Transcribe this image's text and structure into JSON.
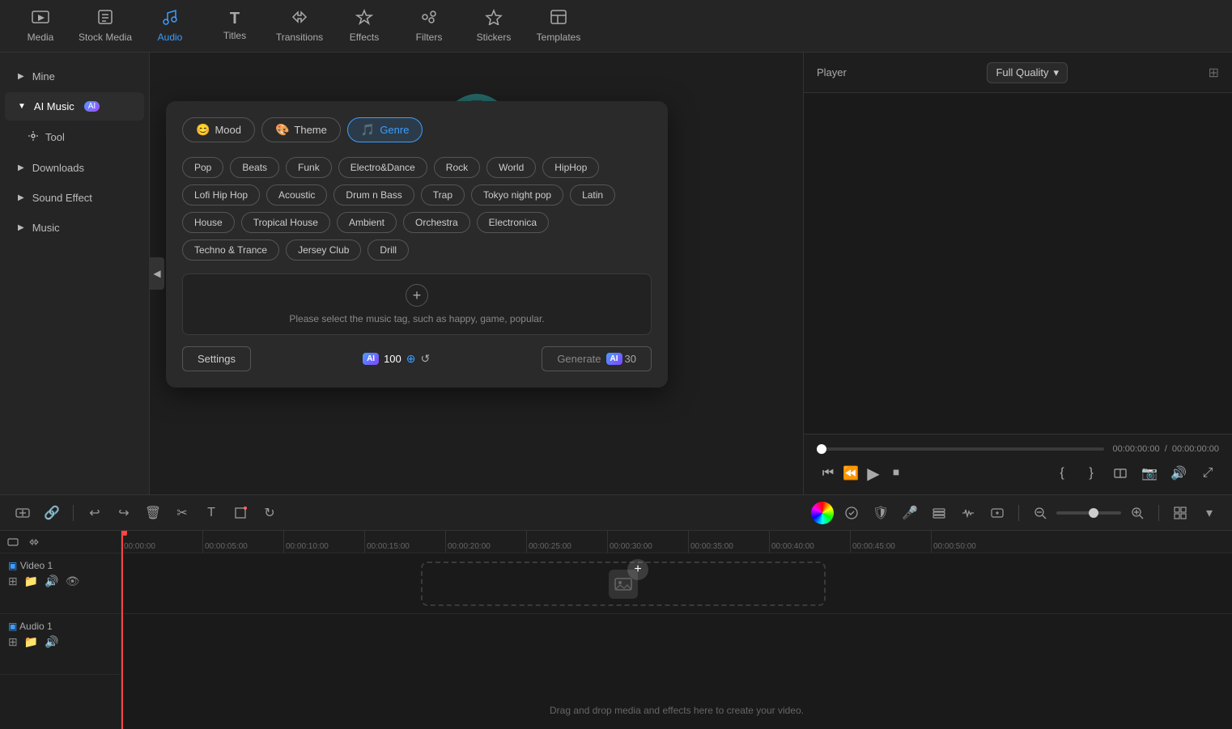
{
  "nav": {
    "items": [
      {
        "id": "media",
        "label": "Media",
        "icon": "🖼"
      },
      {
        "id": "stock-media",
        "label": "Stock Media",
        "icon": "📦"
      },
      {
        "id": "audio",
        "label": "Audio",
        "icon": "🎵",
        "active": true
      },
      {
        "id": "titles",
        "label": "Titles",
        "icon": "T"
      },
      {
        "id": "transitions",
        "label": "Transitions",
        "icon": "↔"
      },
      {
        "id": "effects",
        "label": "Effects",
        "icon": "✨"
      },
      {
        "id": "filters",
        "label": "Filters",
        "icon": "🎛"
      },
      {
        "id": "stickers",
        "label": "Stickers",
        "icon": "⭐"
      },
      {
        "id": "templates",
        "label": "Templates",
        "icon": "⊟"
      }
    ]
  },
  "sidebar": {
    "items": [
      {
        "id": "mine",
        "label": "Mine",
        "caret": "▶",
        "expanded": false
      },
      {
        "id": "ai-music",
        "label": "AI Music",
        "caret": "▼",
        "expanded": true,
        "badge": "AI"
      },
      {
        "id": "tool",
        "label": "Tool",
        "icon": "🔧"
      },
      {
        "id": "downloads",
        "label": "Downloads",
        "caret": "▶",
        "expanded": false
      },
      {
        "id": "sound-effect",
        "label": "Sound Effect",
        "caret": "▶",
        "expanded": false
      },
      {
        "id": "music",
        "label": "Music",
        "caret": "▶",
        "expanded": false
      }
    ]
  },
  "ai_panel": {
    "tabs": [
      {
        "id": "mood",
        "label": "Mood",
        "icon": "😊"
      },
      {
        "id": "theme",
        "label": "Theme",
        "icon": "🎨"
      },
      {
        "id": "genre",
        "label": "Genre",
        "icon": "🎵",
        "active": true
      }
    ],
    "genres": [
      {
        "id": "pop",
        "label": "Pop"
      },
      {
        "id": "beats",
        "label": "Beats"
      },
      {
        "id": "funk",
        "label": "Funk"
      },
      {
        "id": "electro-dance",
        "label": "Electro&Dance"
      },
      {
        "id": "rock",
        "label": "Rock"
      },
      {
        "id": "world",
        "label": "World"
      },
      {
        "id": "hiphop",
        "label": "HipHop"
      },
      {
        "id": "lofi-hip-hop",
        "label": "Lofi Hip Hop"
      },
      {
        "id": "acoustic",
        "label": "Acoustic"
      },
      {
        "id": "drum-n-bass",
        "label": "Drum n Bass"
      },
      {
        "id": "trap",
        "label": "Trap"
      },
      {
        "id": "tokyo-night-pop",
        "label": "Tokyo night pop"
      },
      {
        "id": "latin",
        "label": "Latin"
      },
      {
        "id": "house",
        "label": "House"
      },
      {
        "id": "tropical-house",
        "label": "Tropical House"
      },
      {
        "id": "ambient",
        "label": "Ambient"
      },
      {
        "id": "orchestra",
        "label": "Orchestra"
      },
      {
        "id": "electronica",
        "label": "Electronica"
      },
      {
        "id": "techno-trance",
        "label": "Techno & Trance"
      },
      {
        "id": "jersey-club",
        "label": "Jersey Club"
      },
      {
        "id": "drill",
        "label": "Drill"
      }
    ],
    "hint": "Please select the music tag, such as happy, game, popular.",
    "settings_label": "Settings",
    "credits": "100",
    "generate_label": "Generate",
    "generate_cost": "30"
  },
  "player": {
    "label": "Player",
    "quality": "Full Quality",
    "time_current": "00:00:00:00",
    "time_total": "00:00:00:00"
  },
  "timeline": {
    "ruler_marks": [
      "00:00:00",
      "00:00:05:00",
      "00:00:10:00",
      "00:00:15:00",
      "00:00:20:00",
      "00:00:25:00",
      "00:00:30:00",
      "00:00:35:00",
      "00:00:40:00",
      "00:00:45:00",
      "00:00:50:00"
    ],
    "tracks": [
      {
        "id": "video-1",
        "label": "Video 1"
      },
      {
        "id": "audio-1",
        "label": "Audio 1"
      }
    ],
    "drop_hint": "Drag and drop media and effects here to create your video."
  }
}
